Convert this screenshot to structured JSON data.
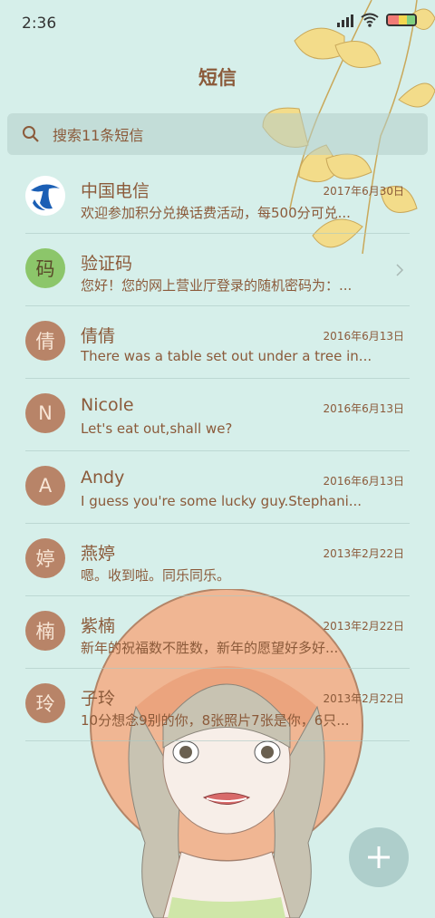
{
  "status_bar": {
    "time": "2:36"
  },
  "header": {
    "title": "短信"
  },
  "search": {
    "placeholder": "搜索11条短信"
  },
  "conversations": [
    {
      "avatar": "",
      "avatar_type": "logo",
      "name": "中国电信",
      "date": "2017年6月30日",
      "preview": "欢迎参加积分兑换话费活动，每500分可兑..."
    },
    {
      "avatar": "码",
      "avatar_type": "green",
      "name": "验证码",
      "date": "",
      "preview": "您好！您的网上营业厅登录的随机密码为：..."
    },
    {
      "avatar": "倩",
      "avatar_type": "brown",
      "name": "倩倩",
      "date": "2016年6月13日",
      "preview": "There was a table set out under a tree in..."
    },
    {
      "avatar": "N",
      "avatar_type": "brown",
      "name": "Nicole",
      "date": "2016年6月13日",
      "preview": "Let's eat out,shall we?"
    },
    {
      "avatar": "A",
      "avatar_type": "brown",
      "name": "Andy",
      "date": "2016年6月13日",
      "preview": "I guess you're some lucky guy.Stephani..."
    },
    {
      "avatar": "婷",
      "avatar_type": "brown",
      "name": "燕婷",
      "date": "2013年2月22日",
      "preview": "嗯。收到啦。同乐同乐。"
    },
    {
      "avatar": "楠",
      "avatar_type": "brown",
      "name": "紫楠",
      "date": "2013年2月22日",
      "preview": "新年的祝福数不胜数，新年的愿望好多好..."
    },
    {
      "avatar": "玲",
      "avatar_type": "brown",
      "name": "子玲",
      "date": "2013年2月22日",
      "preview": "10分想念9别的你，8张照片7张是你，6只..."
    }
  ],
  "icons": {
    "search": "search-icon",
    "compose": "plus-icon",
    "chevron": "chevron-right-icon"
  },
  "colors": {
    "background": "#d6efea",
    "text_brown": "#8b5a3a",
    "avatar_brown": "#b88468",
    "avatar_green": "#8cc66a"
  }
}
